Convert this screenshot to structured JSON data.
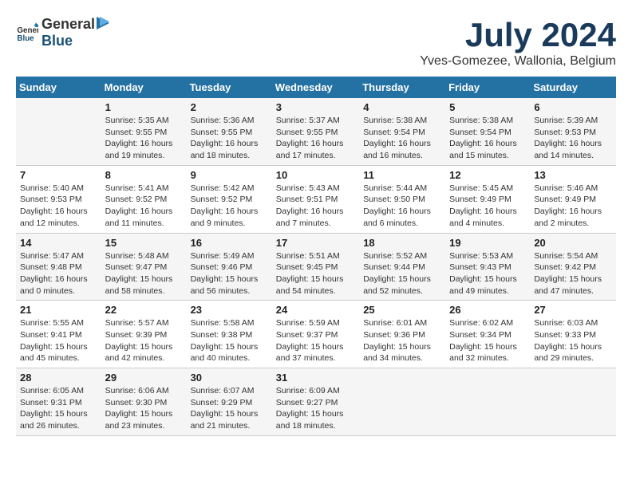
{
  "header": {
    "logo_general": "General",
    "logo_blue": "Blue",
    "month_year": "July 2024",
    "location": "Yves-Gomezee, Wallonia, Belgium"
  },
  "weekdays": [
    "Sunday",
    "Monday",
    "Tuesday",
    "Wednesday",
    "Thursday",
    "Friday",
    "Saturday"
  ],
  "weeks": [
    [
      {
        "day": null,
        "sunrise": null,
        "sunset": null,
        "daylight": null
      },
      {
        "day": "1",
        "sunrise": "Sunrise: 5:35 AM",
        "sunset": "Sunset: 9:55 PM",
        "daylight": "Daylight: 16 hours and 19 minutes."
      },
      {
        "day": "2",
        "sunrise": "Sunrise: 5:36 AM",
        "sunset": "Sunset: 9:55 PM",
        "daylight": "Daylight: 16 hours and 18 minutes."
      },
      {
        "day": "3",
        "sunrise": "Sunrise: 5:37 AM",
        "sunset": "Sunset: 9:55 PM",
        "daylight": "Daylight: 16 hours and 17 minutes."
      },
      {
        "day": "4",
        "sunrise": "Sunrise: 5:38 AM",
        "sunset": "Sunset: 9:54 PM",
        "daylight": "Daylight: 16 hours and 16 minutes."
      },
      {
        "day": "5",
        "sunrise": "Sunrise: 5:38 AM",
        "sunset": "Sunset: 9:54 PM",
        "daylight": "Daylight: 16 hours and 15 minutes."
      },
      {
        "day": "6",
        "sunrise": "Sunrise: 5:39 AM",
        "sunset": "Sunset: 9:53 PM",
        "daylight": "Daylight: 16 hours and 14 minutes."
      }
    ],
    [
      {
        "day": "7",
        "sunrise": "Sunrise: 5:40 AM",
        "sunset": "Sunset: 9:53 PM",
        "daylight": "Daylight: 16 hours and 12 minutes."
      },
      {
        "day": "8",
        "sunrise": "Sunrise: 5:41 AM",
        "sunset": "Sunset: 9:52 PM",
        "daylight": "Daylight: 16 hours and 11 minutes."
      },
      {
        "day": "9",
        "sunrise": "Sunrise: 5:42 AM",
        "sunset": "Sunset: 9:52 PM",
        "daylight": "Daylight: 16 hours and 9 minutes."
      },
      {
        "day": "10",
        "sunrise": "Sunrise: 5:43 AM",
        "sunset": "Sunset: 9:51 PM",
        "daylight": "Daylight: 16 hours and 7 minutes."
      },
      {
        "day": "11",
        "sunrise": "Sunrise: 5:44 AM",
        "sunset": "Sunset: 9:50 PM",
        "daylight": "Daylight: 16 hours and 6 minutes."
      },
      {
        "day": "12",
        "sunrise": "Sunrise: 5:45 AM",
        "sunset": "Sunset: 9:49 PM",
        "daylight": "Daylight: 16 hours and 4 minutes."
      },
      {
        "day": "13",
        "sunrise": "Sunrise: 5:46 AM",
        "sunset": "Sunset: 9:49 PM",
        "daylight": "Daylight: 16 hours and 2 minutes."
      }
    ],
    [
      {
        "day": "14",
        "sunrise": "Sunrise: 5:47 AM",
        "sunset": "Sunset: 9:48 PM",
        "daylight": "Daylight: 16 hours and 0 minutes."
      },
      {
        "day": "15",
        "sunrise": "Sunrise: 5:48 AM",
        "sunset": "Sunset: 9:47 PM",
        "daylight": "Daylight: 15 hours and 58 minutes."
      },
      {
        "day": "16",
        "sunrise": "Sunrise: 5:49 AM",
        "sunset": "Sunset: 9:46 PM",
        "daylight": "Daylight: 15 hours and 56 minutes."
      },
      {
        "day": "17",
        "sunrise": "Sunrise: 5:51 AM",
        "sunset": "Sunset: 9:45 PM",
        "daylight": "Daylight: 15 hours and 54 minutes."
      },
      {
        "day": "18",
        "sunrise": "Sunrise: 5:52 AM",
        "sunset": "Sunset: 9:44 PM",
        "daylight": "Daylight: 15 hours and 52 minutes."
      },
      {
        "day": "19",
        "sunrise": "Sunrise: 5:53 AM",
        "sunset": "Sunset: 9:43 PM",
        "daylight": "Daylight: 15 hours and 49 minutes."
      },
      {
        "day": "20",
        "sunrise": "Sunrise: 5:54 AM",
        "sunset": "Sunset: 9:42 PM",
        "daylight": "Daylight: 15 hours and 47 minutes."
      }
    ],
    [
      {
        "day": "21",
        "sunrise": "Sunrise: 5:55 AM",
        "sunset": "Sunset: 9:41 PM",
        "daylight": "Daylight: 15 hours and 45 minutes."
      },
      {
        "day": "22",
        "sunrise": "Sunrise: 5:57 AM",
        "sunset": "Sunset: 9:39 PM",
        "daylight": "Daylight: 15 hours and 42 minutes."
      },
      {
        "day": "23",
        "sunrise": "Sunrise: 5:58 AM",
        "sunset": "Sunset: 9:38 PM",
        "daylight": "Daylight: 15 hours and 40 minutes."
      },
      {
        "day": "24",
        "sunrise": "Sunrise: 5:59 AM",
        "sunset": "Sunset: 9:37 PM",
        "daylight": "Daylight: 15 hours and 37 minutes."
      },
      {
        "day": "25",
        "sunrise": "Sunrise: 6:01 AM",
        "sunset": "Sunset: 9:36 PM",
        "daylight": "Daylight: 15 hours and 34 minutes."
      },
      {
        "day": "26",
        "sunrise": "Sunrise: 6:02 AM",
        "sunset": "Sunset: 9:34 PM",
        "daylight": "Daylight: 15 hours and 32 minutes."
      },
      {
        "day": "27",
        "sunrise": "Sunrise: 6:03 AM",
        "sunset": "Sunset: 9:33 PM",
        "daylight": "Daylight: 15 hours and 29 minutes."
      }
    ],
    [
      {
        "day": "28",
        "sunrise": "Sunrise: 6:05 AM",
        "sunset": "Sunset: 9:31 PM",
        "daylight": "Daylight: 15 hours and 26 minutes."
      },
      {
        "day": "29",
        "sunrise": "Sunrise: 6:06 AM",
        "sunset": "Sunset: 9:30 PM",
        "daylight": "Daylight: 15 hours and 23 minutes."
      },
      {
        "day": "30",
        "sunrise": "Sunrise: 6:07 AM",
        "sunset": "Sunset: 9:29 PM",
        "daylight": "Daylight: 15 hours and 21 minutes."
      },
      {
        "day": "31",
        "sunrise": "Sunrise: 6:09 AM",
        "sunset": "Sunset: 9:27 PM",
        "daylight": "Daylight: 15 hours and 18 minutes."
      },
      {
        "day": null,
        "sunrise": null,
        "sunset": null,
        "daylight": null
      },
      {
        "day": null,
        "sunrise": null,
        "sunset": null,
        "daylight": null
      },
      {
        "day": null,
        "sunrise": null,
        "sunset": null,
        "daylight": null
      }
    ]
  ]
}
